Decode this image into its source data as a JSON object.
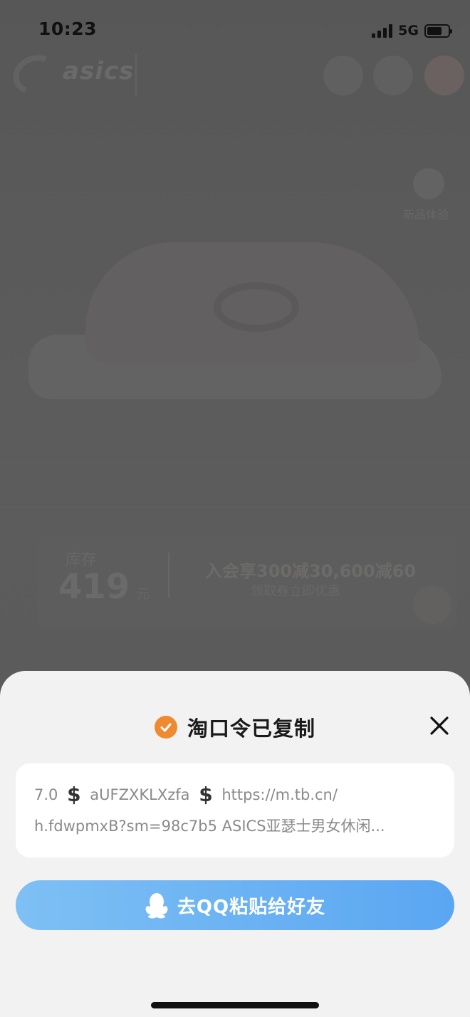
{
  "status_bar": {
    "time": "10:23",
    "network": "5G"
  },
  "background_page": {
    "brand": "asics",
    "side_label": "新品体验",
    "card": {
      "label": "库存",
      "value": "419",
      "unit": "元",
      "promo_line1": "入会享300减30,600减60",
      "promo_line2": "领取券立即优惠"
    }
  },
  "sheet": {
    "title": "淘口令已复制",
    "icons": {
      "title_icon": "check-circle-icon",
      "close_icon": "close-icon",
      "qq_icon": "qq-penguin-icon"
    },
    "content": {
      "line1_prefix": "7.0",
      "symbol": "$",
      "code": "aUFZXKLXzfa",
      "url_part1": "https://m.tb.cn/",
      "line2": "h.fdwpmxB?sm=98c7b5  ASICS亚瑟士男女休闲..."
    },
    "button_label": "去QQ粘贴给好友"
  },
  "colors": {
    "accent_orange": "#f08a30",
    "button_blue_start": "#7ec0f4",
    "button_blue_end": "#5aa6f2",
    "sheet_bg": "#f2f2f2",
    "overlay_bg": "#5a5a5a"
  }
}
